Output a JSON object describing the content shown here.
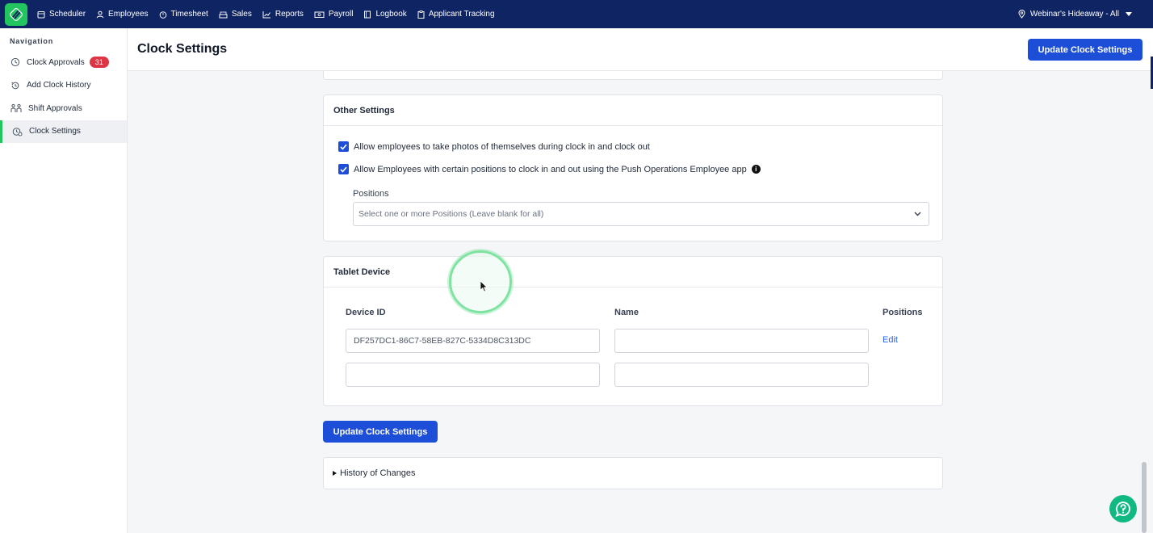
{
  "topnav": {
    "items": [
      {
        "label": "Scheduler",
        "icon": "calendar-icon"
      },
      {
        "label": "Employees",
        "icon": "user-icon"
      },
      {
        "label": "Timesheet",
        "icon": "stopwatch-icon"
      },
      {
        "label": "Sales",
        "icon": "money-stack-icon"
      },
      {
        "label": "Reports",
        "icon": "chart-line-icon"
      },
      {
        "label": "Payroll",
        "icon": "cash-icon"
      },
      {
        "label": "Logbook",
        "icon": "book-icon"
      },
      {
        "label": "Applicant Tracking",
        "icon": "clipboard-icon"
      }
    ],
    "location": "Webinar's Hideaway - All"
  },
  "sidebar": {
    "heading": "Navigation",
    "items": [
      {
        "label": "Clock Approvals",
        "badge": "31",
        "icon": "clock-icon"
      },
      {
        "label": "Add Clock History",
        "icon": "history-icon"
      },
      {
        "label": "Shift Approvals",
        "icon": "swap-people-icon"
      },
      {
        "label": "Clock Settings",
        "icon": "clock-settings-icon",
        "active": true
      }
    ]
  },
  "header": {
    "title": "Clock Settings",
    "update_button": "Update Clock Settings"
  },
  "other_settings": {
    "title": "Other Settings",
    "checkbox_photos": "Allow employees to take photos of themselves during clock in and clock out",
    "checkbox_positions": "Allow Employees with certain positions to clock in and out using the Push Operations Employee app",
    "positions_label": "Positions",
    "positions_placeholder": "Select one or more Positions (Leave blank for all)"
  },
  "tablet_device": {
    "title": "Tablet Device",
    "col_device_id": "Device ID",
    "col_name": "Name",
    "col_positions": "Positions",
    "rows": [
      {
        "device_id": "DF257DC1-86C7-58EB-827C-5334D8C313DC",
        "name": "",
        "action": "Edit"
      },
      {
        "device_id": "",
        "name": "",
        "action": ""
      }
    ]
  },
  "bottom_update_button": "Update Clock Settings",
  "history": {
    "label": "History of Changes"
  },
  "colors": {
    "topbar": "#0f2463",
    "primary": "#1d4ed8",
    "accent_green": "#22c55e",
    "badge_red": "#dc3545"
  }
}
